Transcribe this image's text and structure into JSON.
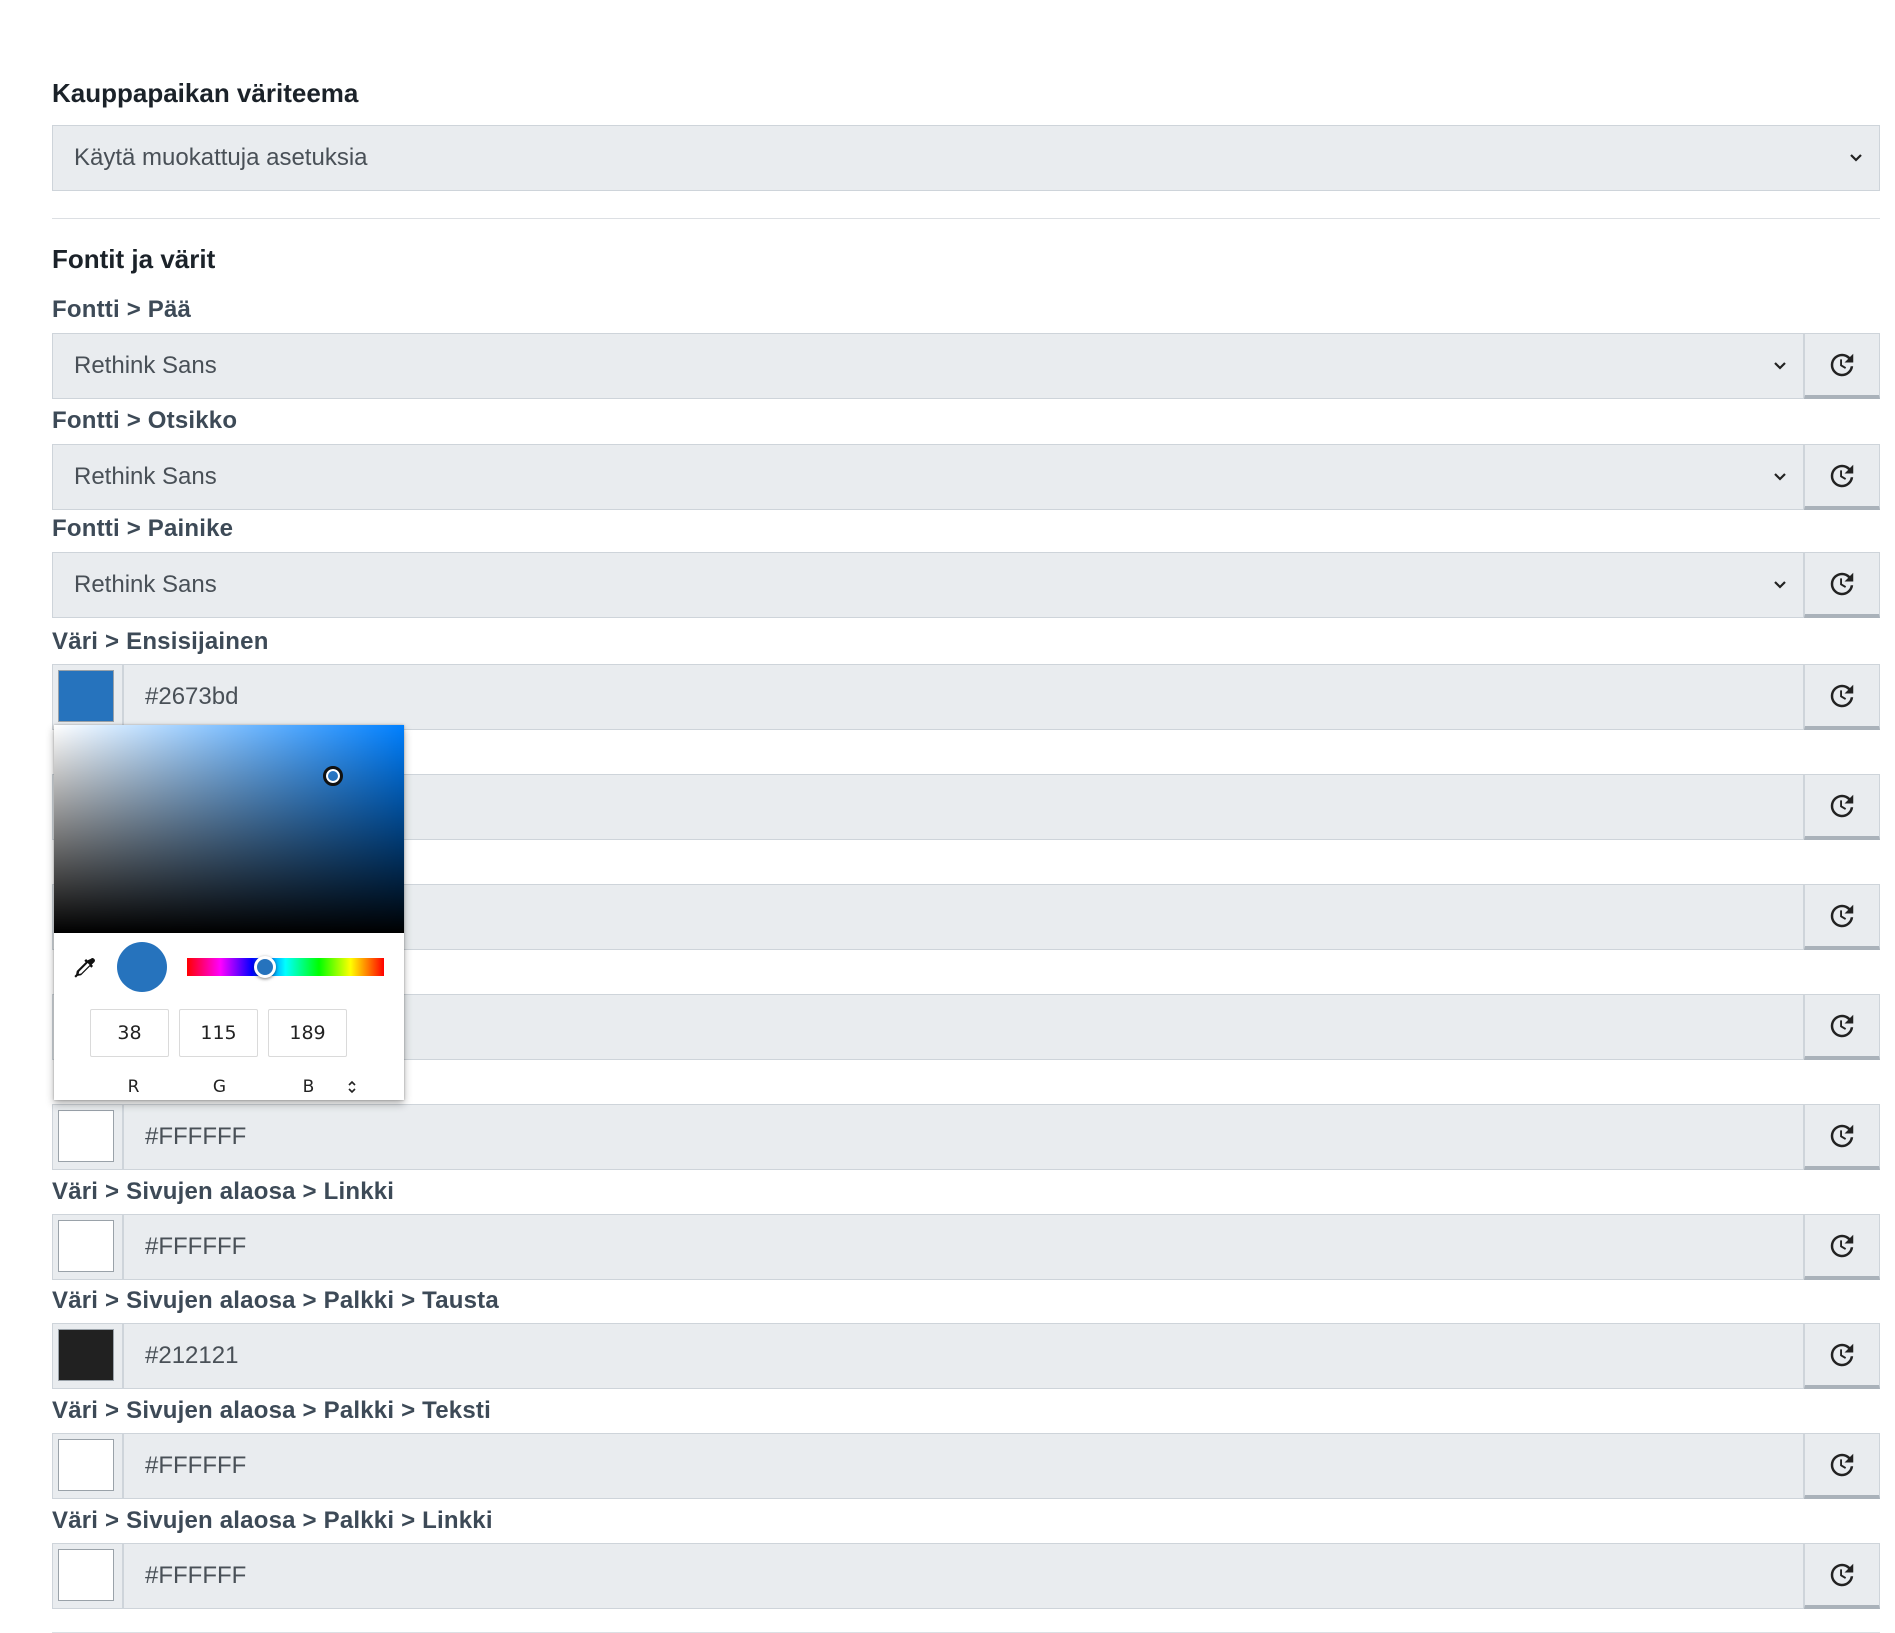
{
  "theme": {
    "heading": "Kauppapaikan väriteema",
    "selected": "Käytä muokattuja asetuksia"
  },
  "fonts_colors": {
    "heading": "Fontit ja värit",
    "fields": [
      {
        "label": "Fontti > Pää",
        "value": "Rethink Sans"
      },
      {
        "label": "Fontti > Otsikko",
        "value": "Rethink Sans"
      },
      {
        "label": "Fontti > Painike",
        "value": "Rethink Sans"
      }
    ],
    "colors": [
      {
        "label": "Väri > Ensisijainen",
        "value": "#2673bd",
        "swatch": "#2673bd"
      },
      {
        "label": "",
        "value": "",
        "swatch": ""
      },
      {
        "label": "",
        "value": "",
        "swatch": ""
      },
      {
        "label": "",
        "value": "",
        "swatch": ""
      },
      {
        "label": "",
        "value": "#FFFFFF",
        "swatch": "#FFFFFF"
      },
      {
        "label": "Väri > Sivujen alaosa > Linkki",
        "value": "#FFFFFF",
        "swatch": "#FFFFFF"
      },
      {
        "label": "Väri > Sivujen alaosa > Palkki > Tausta",
        "value": "#212121",
        "swatch": "#212121"
      },
      {
        "label": "Väri > Sivujen alaosa > Palkki > Teksti",
        "value": "#FFFFFF",
        "swatch": "#FFFFFF"
      },
      {
        "label": "Väri > Sivujen alaosa > Palkki > Linkki",
        "value": "#FFFFFF",
        "swatch": "#FFFFFF"
      }
    ]
  },
  "picker": {
    "r": "38",
    "g": "115",
    "b": "189",
    "r_label": "R",
    "g_label": "G",
    "b_label": "B",
    "color": "#2673bd"
  },
  "icons": {
    "reset": "history-icon",
    "dropdown": "chevron-down-icon",
    "eyedropper": "eyedropper-icon",
    "mode_toggle": "up-down-arrows-icon"
  }
}
